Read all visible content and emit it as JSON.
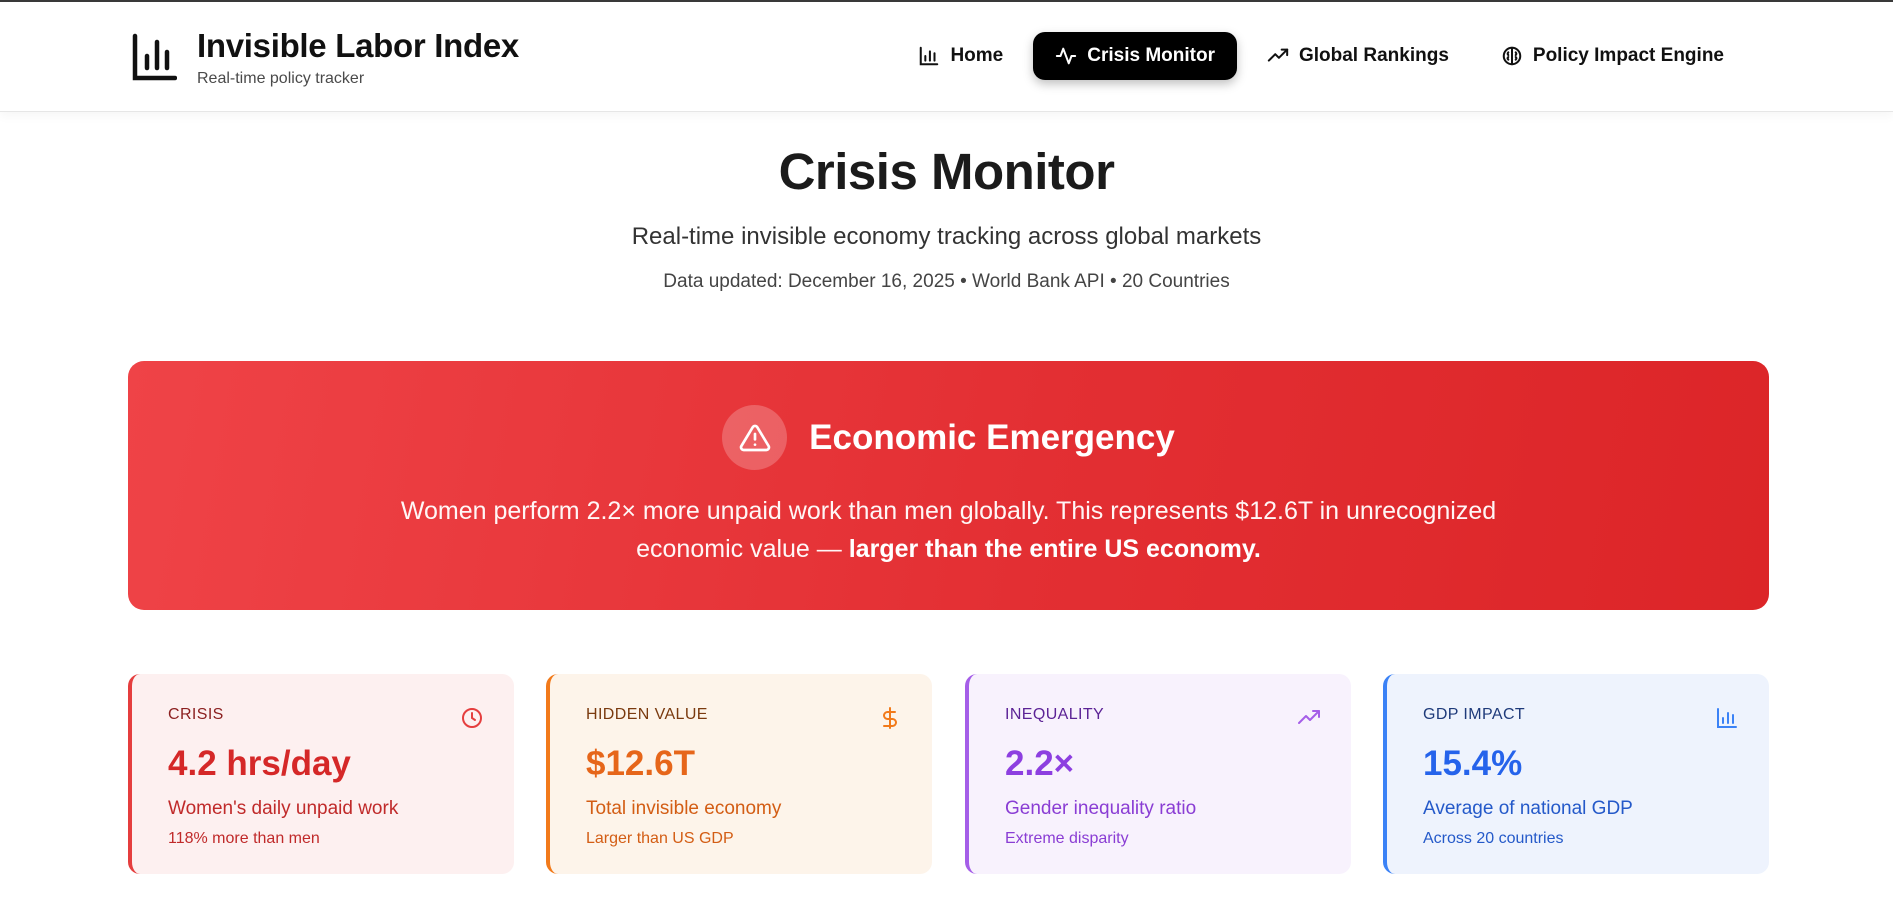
{
  "brand": {
    "title": "Invisible Labor Index",
    "subtitle": "Real-time policy tracker",
    "icon": "bar-chart-icon"
  },
  "nav": {
    "items": [
      {
        "label": "Home",
        "icon": "bar-chart-icon",
        "active": false
      },
      {
        "label": "Crisis Monitor",
        "icon": "activity-icon",
        "active": true
      },
      {
        "label": "Global Rankings",
        "icon": "trending-up-icon",
        "active": false
      },
      {
        "label": "Policy Impact Engine",
        "icon": "brain-icon",
        "active": false
      }
    ]
  },
  "hero": {
    "title": "Crisis Monitor",
    "subtitle": "Real-time invisible economy tracking across global markets",
    "meta": "Data updated: December 16, 2025 • World Bank API • 20 Countries"
  },
  "alert": {
    "icon": "alert-triangle-icon",
    "title": "Economic Emergency",
    "text": "Women perform 2.2× more unpaid work than men globally. This represents $12.6T in unrecognized economic value — ",
    "emphasis": "larger than the entire US economy."
  },
  "cards": [
    {
      "label": "CRISIS",
      "icon": "clock-icon",
      "value": "4.2 hrs/day",
      "desc": "Women's daily unpaid work",
      "note": "118% more than men",
      "accent": "#e53e3e"
    },
    {
      "label": "HIDDEN VALUE",
      "icon": "dollar-icon",
      "value": "$12.6T",
      "desc": "Total invisible economy",
      "note": "Larger than US GDP",
      "accent": "#f27a1a"
    },
    {
      "label": "INEQUALITY",
      "icon": "trending-up-icon",
      "value": "2.2×",
      "desc": "Gender inequality ratio",
      "note": "Extreme disparity",
      "accent": "#a55ee8"
    },
    {
      "label": "GDP IMPACT",
      "icon": "bar-chart-icon",
      "value": "15.4%",
      "desc": "Average of national GDP",
      "note": "Across 20 countries",
      "accent": "#3b82f6"
    }
  ]
}
